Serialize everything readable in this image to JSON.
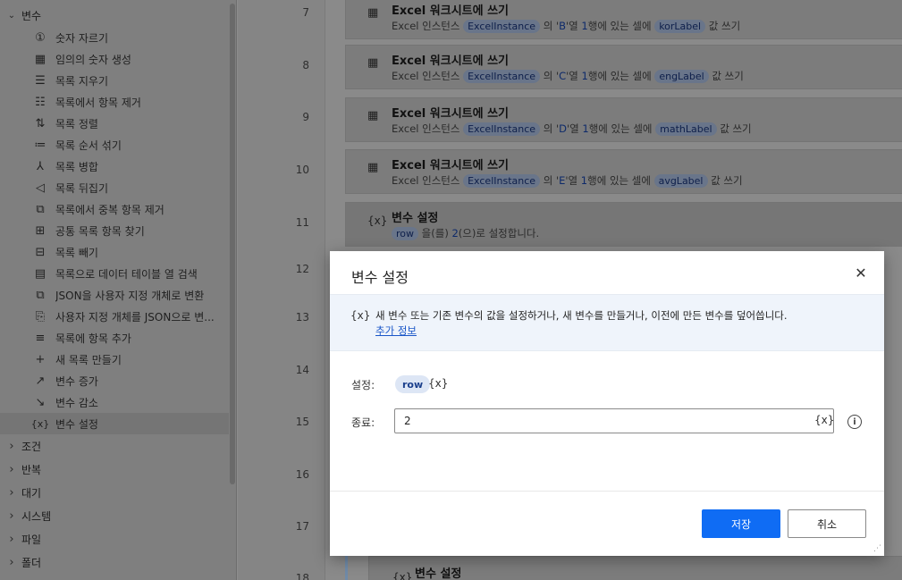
{
  "actions_panel": {
    "top_category": "변수",
    "items": [
      {
        "label": "숫자 자르기",
        "icon": "number-circle-icon"
      },
      {
        "label": "임의의 숫자 생성",
        "icon": "random-number-icon"
      },
      {
        "label": "목록 지우기",
        "icon": "list-clear-icon"
      },
      {
        "label": "목록에서 항목 제거",
        "icon": "list-remove-icon"
      },
      {
        "label": "목록 정렬",
        "icon": "sort-icon"
      },
      {
        "label": "목록 순서 섞기",
        "icon": "shuffle-icon"
      },
      {
        "label": "목록 병합",
        "icon": "merge-icon"
      },
      {
        "label": "목록 뒤집기",
        "icon": "reverse-icon"
      },
      {
        "label": "목록에서 중복 항목 제거",
        "icon": "dedupe-icon"
      },
      {
        "label": "공통 목록 항목 찾기",
        "icon": "common-items-icon"
      },
      {
        "label": "목록 빼기",
        "icon": "subtract-list-icon"
      },
      {
        "label": "목록으로 데이터 테이블 열 검색",
        "icon": "table-column-icon"
      },
      {
        "label": "JSON을 사용자 지정 개체로 변환",
        "icon": "json-convert-icon"
      },
      {
        "label": "사용자 지정 개체를 JSON으로 변...",
        "icon": "json-file-icon"
      },
      {
        "label": "목록에 항목 추가",
        "icon": "list-add-icon"
      },
      {
        "label": "새 목록 만들기",
        "icon": "plus-icon"
      },
      {
        "label": "변수 증가",
        "icon": "increase-icon"
      },
      {
        "label": "변수 감소",
        "icon": "decrease-icon"
      },
      {
        "label": "변수 설정",
        "icon": "variable-icon"
      }
    ],
    "categories": [
      "조건",
      "반복",
      "대기",
      "시스템",
      "파일",
      "폴더"
    ]
  },
  "flow": {
    "line_numbers": [
      "7",
      "8",
      "9",
      "10",
      "11",
      "12",
      "13",
      "14",
      "15",
      "16",
      "17",
      "18"
    ],
    "steps": [
      {
        "title": "Excel 워크시트에 쓰기",
        "prefix": "Excel 인스턴스",
        "instance": "ExcelInstance",
        "mid1": "의 '",
        "col": "B",
        "mid2": "'열 ",
        "row": "1",
        "mid3": "행에 있는 셀에",
        "var": "korLabel",
        "suffix": "값 쓰기"
      },
      {
        "title": "Excel 워크시트에 쓰기",
        "prefix": "Excel 인스턴스",
        "instance": "ExcelInstance",
        "mid1": "의 '",
        "col": "C",
        "mid2": "'열 ",
        "row": "1",
        "mid3": "행에 있는 셀에",
        "var": "engLabel",
        "suffix": "값 쓰기"
      },
      {
        "title": "Excel 워크시트에 쓰기",
        "prefix": "Excel 인스턴스",
        "instance": "ExcelInstance",
        "mid1": "의 '",
        "col": "D",
        "mid2": "'열 ",
        "row": "1",
        "mid3": "행에 있는 셀에",
        "var": "mathLabel",
        "suffix": "값 쓰기"
      },
      {
        "title": "Excel 워크시트에 쓰기",
        "prefix": "Excel 인스턴스",
        "instance": "ExcelInstance",
        "mid1": "의 '",
        "col": "E",
        "mid2": "'열 ",
        "row": "1",
        "mid3": "행에 있는 셀에",
        "var": "avgLabel",
        "suffix": "값 쓰기"
      }
    ],
    "set_step": {
      "title": "변수 설정",
      "var": "row",
      "mid": "을(를) ",
      "value": "2",
      "suffix": "(으)로 설정합니다."
    },
    "bottom_step_title": "변수 설정",
    "var_glyph": "{x}"
  },
  "modal": {
    "title": "변수 설정",
    "close_glyph": "✕",
    "banner_text": "새 변수 또는 기존 변수의 값을 설정하거나, 새 변수를 만들거나, 이전에 만든 변수를 덮어씁니다.",
    "banner_link": "추가 정보",
    "set_label": "설정:",
    "set_var": "row",
    "value_label": "종료:",
    "value": "2",
    "var_glyph": "{x}",
    "info_glyph": "i",
    "save_label": "저장",
    "cancel_label": "취소"
  }
}
